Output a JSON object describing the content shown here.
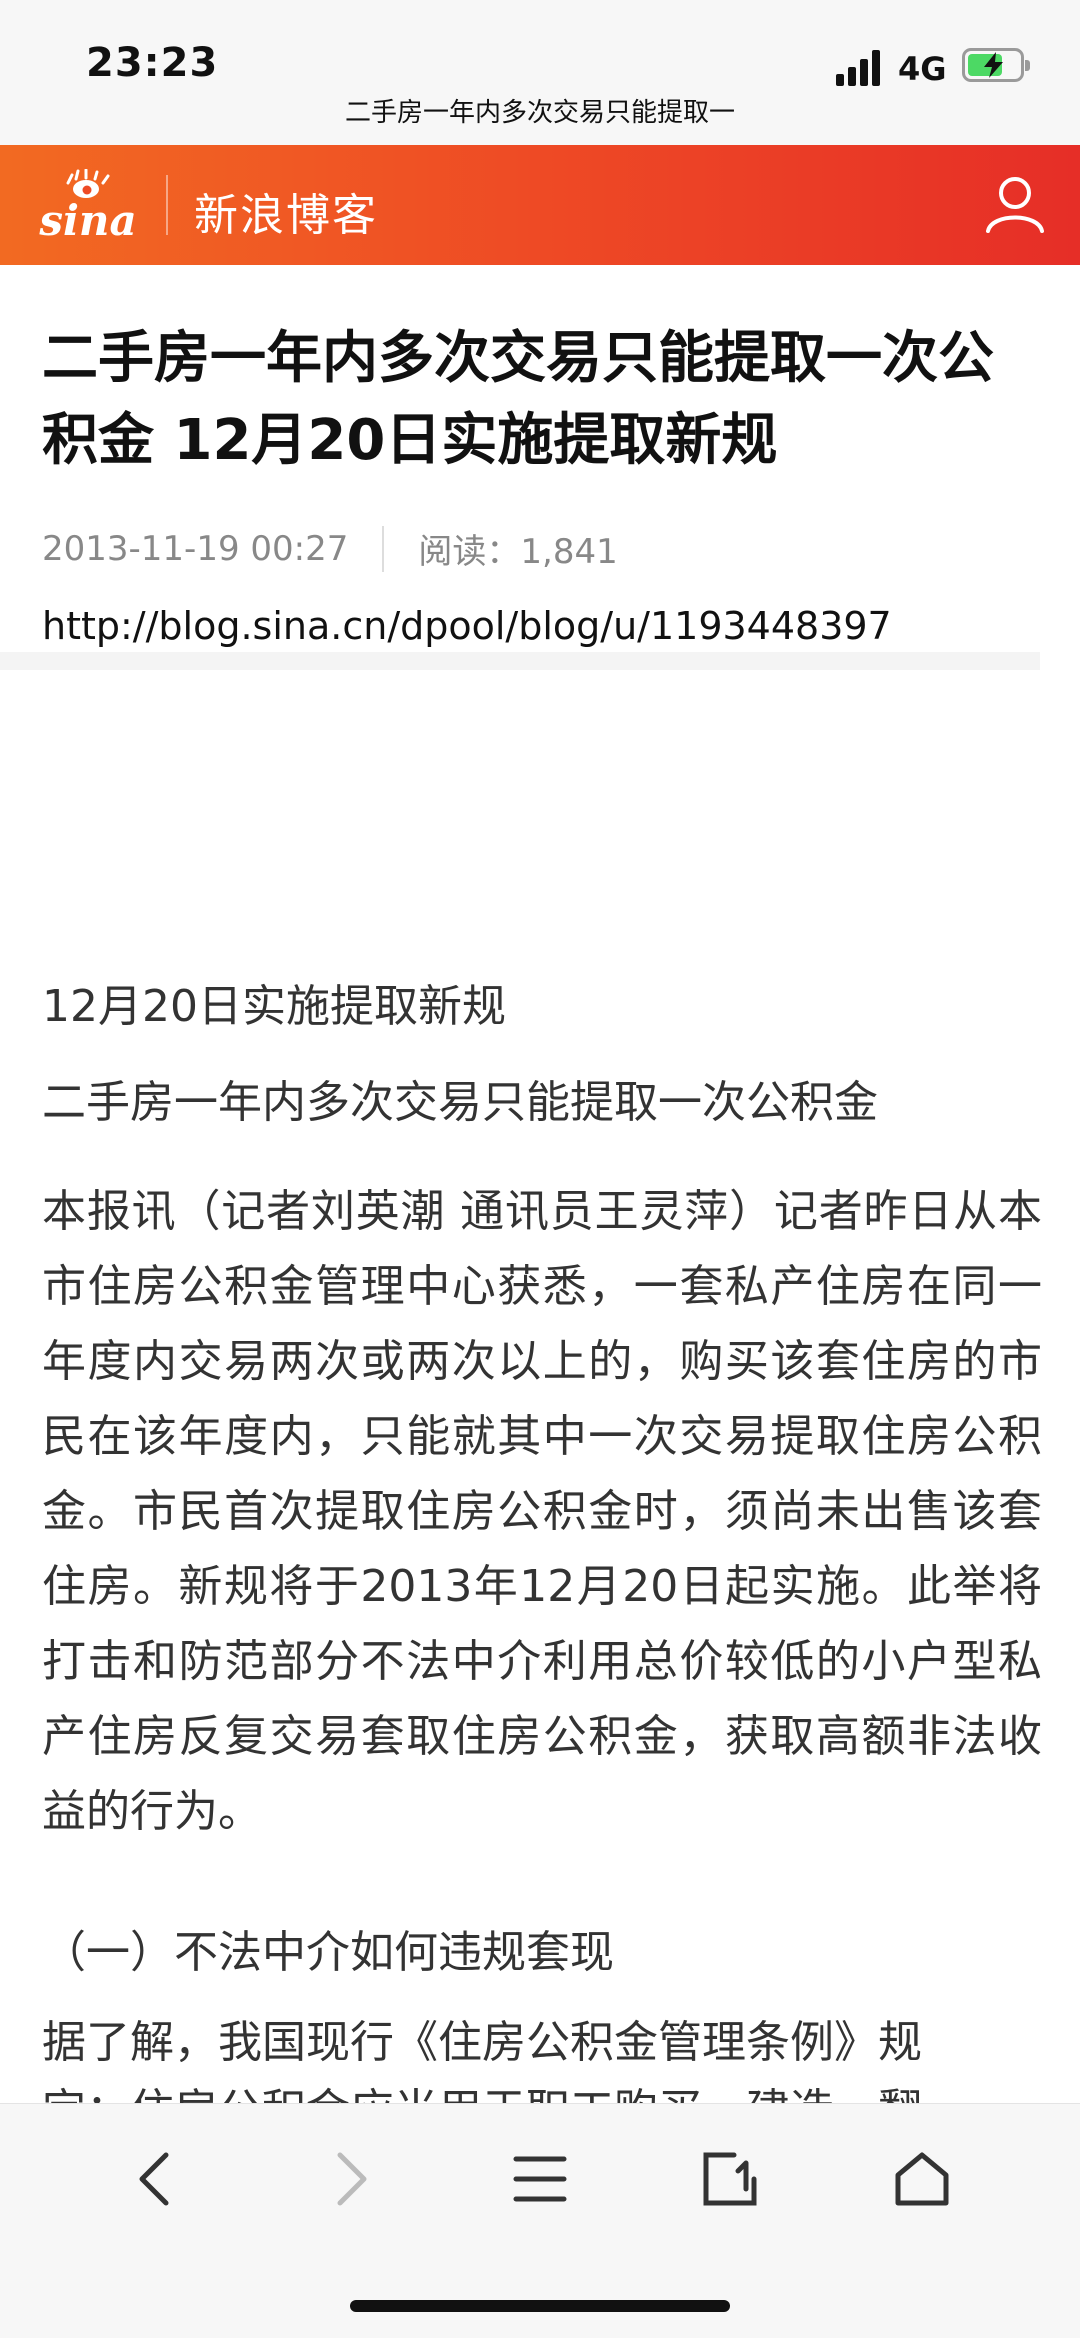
{
  "status_bar": {
    "time": "23:23",
    "network": "4G",
    "page_title": "二手房一年内多次交易只能提取一"
  },
  "header": {
    "logo_text": "sina",
    "brand": "新浪博客",
    "accent_color": "#ee4a25",
    "user_icon": "user-icon"
  },
  "article": {
    "title": "二手房一年内多次交易只能提取一次公积金 12月20日实施提取新规",
    "date": "2013-11-19 00:27",
    "reads": "阅读：1,841",
    "url": "http://blog.sina.cn/dpool/blog/u/1193448397",
    "lines": [
      "12月20日实施提取新规",
      "二手房一年内多次交易只能提取一次公积金"
    ],
    "paragraph": "本报讯（记者刘英潮 通讯员王灵萍）记者昨日从本市住房公积金管理中心获悉，一套私产住房在同一年度内交易两次或两次以上的，购买该套住房的市民在该年度内，只能就其中一次交易提取住房公积金。市民首次提取住房公积金时，须尚未出售该套住房。新规将于2013年12月20日起实施。此举将打击和防范部分不法中介利用总价较低的小户型私产住房反复交易套取住房公积金，获取高额非法收益的行为。",
    "section_heading": "（一）不法中介如何违规套现",
    "section_first_line": "据了解，我国现行《住房公积金管理条例》规",
    "section_partial_line": "定：住房公积金应当用于职工购买、建造、翻"
  },
  "bottom_bar": {
    "back_icon": "chevron-left-icon",
    "forward_icon": "chevron-right-icon",
    "menu_icon": "menu-icon",
    "tabs_icon": "tabs-icon",
    "home_icon": "home-icon"
  }
}
